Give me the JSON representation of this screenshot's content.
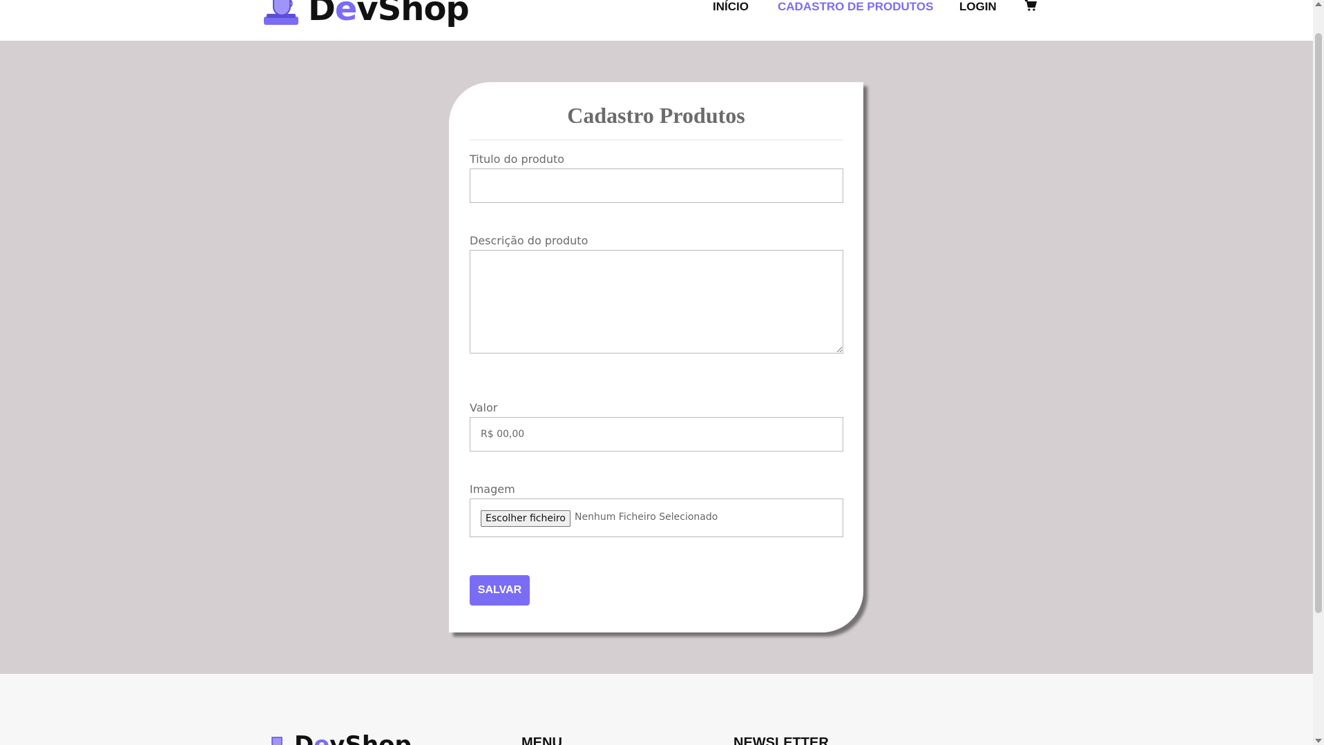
{
  "brand": {
    "name_prefix": "D",
    "name_accent": "e",
    "name_suffix": "vShop",
    "accent_color": "#7b6cf6"
  },
  "nav": {
    "items": [
      {
        "label": "INÍCIO"
      },
      {
        "label": "CADASTRO DE PRODUTOS"
      },
      {
        "label": "LOGIN"
      }
    ],
    "cart_icon": "cart-icon"
  },
  "form": {
    "title": "Cadastro Produtos",
    "title_field": {
      "label": "Titulo do produto",
      "value": ""
    },
    "description_field": {
      "label": "Descrição do produto",
      "value": ""
    },
    "price_field": {
      "label": "Valor",
      "placeholder": "R$ 00,00"
    },
    "image_field": {
      "label": "Imagem",
      "button_label": "Escolher ficheiro",
      "status": "Nenhum Ficheiro Selecionado"
    },
    "save_label": "SALVAR"
  },
  "footer": {
    "brand": {
      "name_prefix": "D",
      "name_accent": "e",
      "name_suffix": "vShop"
    },
    "menu_heading": "MENU",
    "newsletter_heading": "NEWSLETTER"
  }
}
